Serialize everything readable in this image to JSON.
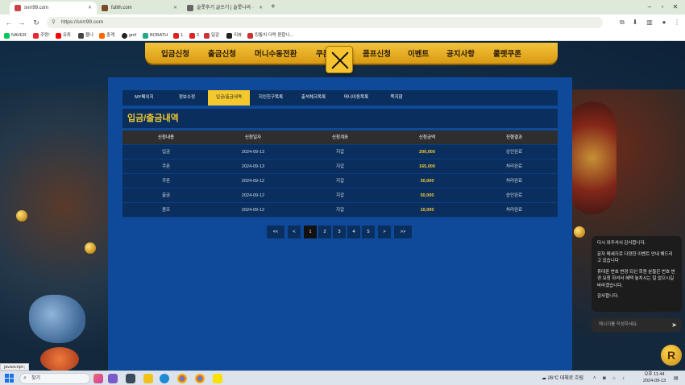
{
  "browser": {
    "tabs": [
      {
        "title": "snrr99.com",
        "active": true
      },
      {
        "title": "fullth.com",
        "active": false
      },
      {
        "title": "슬롯후기 글쓰기 | 슬롯나라 ·",
        "active": false
      }
    ],
    "url": "https://snrr99.com",
    "bookmarks": [
      "NAVER",
      "주랑!",
      "유튜",
      "블나",
      "중계",
      "gmf",
      "BOBATH",
      "1",
      "2",
      "일감",
      "리뷰",
      "킹통치 더락 편합니..."
    ]
  },
  "site_nav": {
    "items": [
      "입금신청",
      "출금신청",
      "머니수동전환",
      "쿠폰",
      "콤프신청",
      "이벤트",
      "공지사항",
      "룰렛쿠폰"
    ]
  },
  "subtabs": [
    {
      "label": "MY페이지",
      "active": false
    },
    {
      "label": "정보수정",
      "active": false
    },
    {
      "label": "입금/출금내역",
      "active": true
    },
    {
      "label": "지인친구목록",
      "active": false
    },
    {
      "label": "출석체크목록",
      "active": false
    },
    {
      "label": "머니이동목록",
      "active": false
    },
    {
      "label": "쪽지함",
      "active": false
    }
  ],
  "section_title": "입금/출금내역",
  "table": {
    "headers": [
      "신청내용",
      "신청일자",
      "신청계좌",
      "신청금액",
      "진행결과"
    ],
    "rows": [
      [
        "입금",
        "2024-09-13",
        "지갑",
        "200,000",
        "승인완료"
      ],
      [
        "쿠폰",
        "2024-09-13",
        "지갑",
        "165,000",
        "처리완료"
      ],
      [
        "쿠폰",
        "2024-09-12",
        "지갑",
        "30,000",
        "처리완료"
      ],
      [
        "출금",
        "2024-09-12",
        "지갑",
        "50,000",
        "승인완료"
      ],
      [
        "콤프",
        "2024-09-12",
        "지갑",
        "10,000",
        "처리완료"
      ]
    ]
  },
  "pager": {
    "first": "<<",
    "prev": "<",
    "pages": [
      "1",
      "2",
      "3",
      "4",
      "5"
    ],
    "current": "1",
    "next": ">",
    "last": ">>"
  },
  "chat": {
    "messages": [
      "다시 와주셔서 감사합니다.",
      "문자 메세지로 다양한 이벤트 안내 해드리고 있습니다",
      "휴대폰 번호 변경 되신 회원 분들은 번호 변경 요청 하셔서 혜택 놓치시는 일 없으시길 바라겠습니다.",
      "감사합니다."
    ],
    "input_placeholder": "메시지를 작성하세요.",
    "badge": "R"
  },
  "status_text": "javascript:;",
  "taskbar": {
    "search_label": "찾기",
    "weather": "26°C  대체로 흐림",
    "time": "오후 11:44",
    "date": "2024-09-13"
  },
  "colors": {
    "accent": "#f5c92e",
    "panel": "#0f4a9a",
    "panel_dark": "#0a2f5e"
  }
}
